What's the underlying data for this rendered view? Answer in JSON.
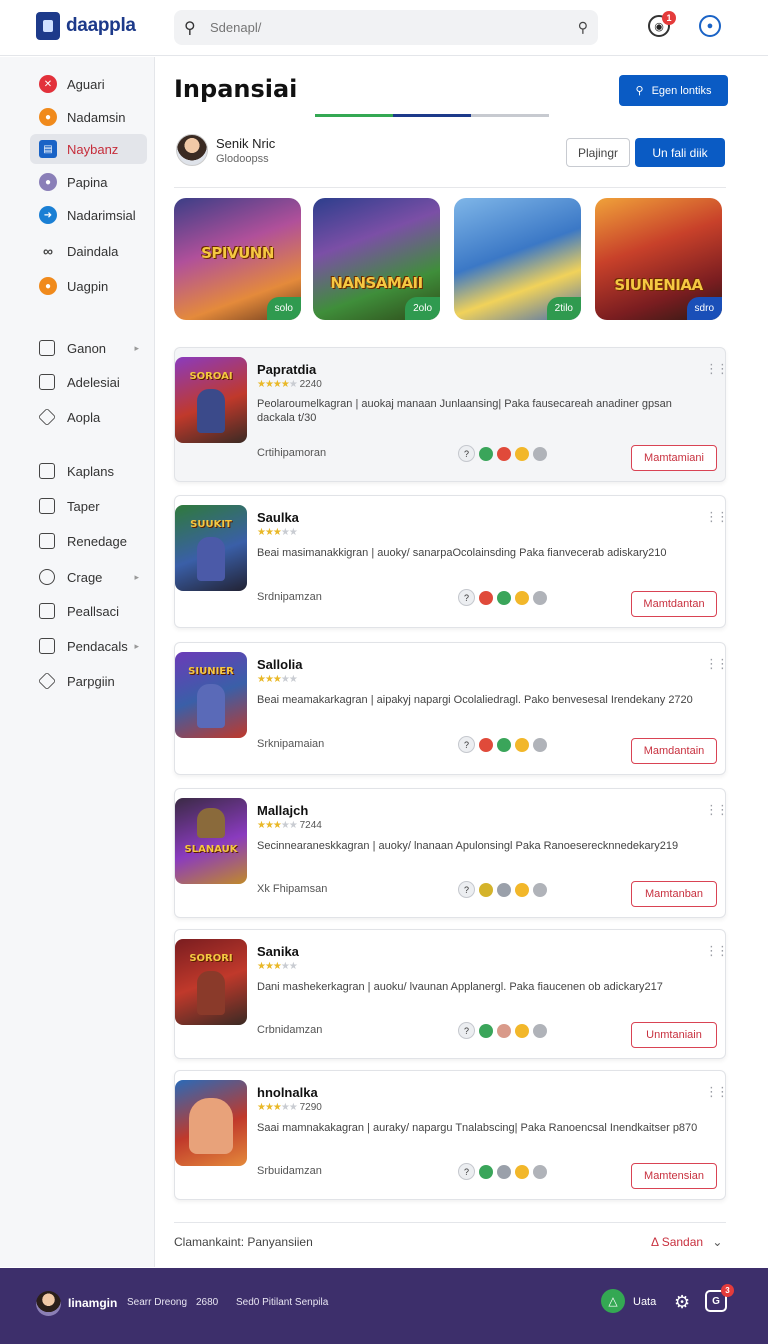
{
  "header": {
    "logo_text": "daappla",
    "search_placeholder": "Sdenapl/",
    "notification_count": "1"
  },
  "sidebar": {
    "items": [
      {
        "label": "Aguari",
        "color": "#e2313b"
      },
      {
        "label": "Nadamsin",
        "color": "#f08a1c"
      },
      {
        "label": "Naybanz",
        "color": "#1a63c6"
      },
      {
        "label": "Papina",
        "color": "#8a7fb8"
      },
      {
        "label": "Nadarimsial",
        "color": "#1a7fd4"
      },
      {
        "label": "Daindala",
        "color": ""
      },
      {
        "label": "Uagpin",
        "color": "#f08a1c"
      }
    ],
    "secondary": [
      {
        "label": "Ganon",
        "has_arrow": true
      },
      {
        "label": "Adelesiai",
        "has_arrow": false
      },
      {
        "label": "Aopla",
        "has_arrow": false
      }
    ],
    "tertiary": [
      {
        "label": "Kaplans",
        "has_arrow": false
      },
      {
        "label": "Taper",
        "has_arrow": false
      },
      {
        "label": "Renedage",
        "has_arrow": false
      },
      {
        "label": "Crage",
        "has_arrow": true
      },
      {
        "label": "Peallsaci",
        "has_arrow": false
      },
      {
        "label": "Pendacals",
        "has_arrow": true
      },
      {
        "label": "Parpgiin",
        "has_arrow": false
      }
    ]
  },
  "main": {
    "title": "Inpansiai",
    "explore_label": "Egen lontiks",
    "profile": {
      "name": "Senik Nric",
      "sub": "Glodoopss",
      "secondary_button": "Plajingr",
      "primary_button": "Un fali diik"
    },
    "featured": [
      {
        "title": "SPIVUNN",
        "tag": "solo"
      },
      {
        "title": "NANSAMAII",
        "tag": "2olo"
      },
      {
        "title": "",
        "tag": "2tilo"
      },
      {
        "title": "SIUNENIAA",
        "tag": "sdro"
      }
    ],
    "cards": [
      {
        "title": "Papratdia",
        "rating": "2240",
        "stars": 4,
        "desc": "Peolaroumelkagran | auokaj manaan Junlaansing| Paka fausecareah anadiner gpsan dackala t/30",
        "category": "Crtihipamoran",
        "cta": "Mamtamiani"
      },
      {
        "title": "Saulka",
        "rating": "",
        "stars": 3,
        "desc": "Beai masimanakkigran | auoky/ sanarpaOcolainsding Paka fianvecerab adiskary210",
        "category": "Srdnipamzan",
        "cta": "Mamtdantan"
      },
      {
        "title": "Sallolia",
        "rating": "",
        "stars": 3,
        "desc": "Beai meamakarkagran | aipakyj napargi Ocolaliedragl. Pako benvesesal Irendekany 2720",
        "category": "Srknipamaian",
        "cta": "Mamdantain"
      },
      {
        "title": "Mallajch",
        "rating": "7244",
        "stars": 3,
        "desc": "Secinnearaneskkagran | auoky/ lnanaan Apulonsingl Paka Ranoeserecknnedekary219",
        "category": "Xk Fhipamsan",
        "cta": "Mamtanban"
      },
      {
        "title": "Sanika",
        "rating": "",
        "stars": 3,
        "desc": "Dani mashekerkagran | auoku/ lvaunan Applanergl. Paka fiaucenen ob adickary217",
        "category": "Crbnidamzan",
        "cta": "Unmtaniain"
      },
      {
        "title": "hnolnalka",
        "rating": "7290",
        "stars": 3,
        "desc": "Saai mamnakakagran | auraky/ napargu Tnalabscing| Paka Ranoencsal Inendkaitser p870",
        "category": "Srbuidamzan",
        "cta": "Mamtensian"
      }
    ],
    "footer_left": "Clamankaint: Panyansiien",
    "footer_right": "Sandan"
  },
  "bottombar": {
    "name": "Iinamgin",
    "text1": "Searr Dreong",
    "text2": "2680",
    "text3": "Sed0 Pitilant Senpila",
    "label": "Uata",
    "chat_count": "3"
  }
}
